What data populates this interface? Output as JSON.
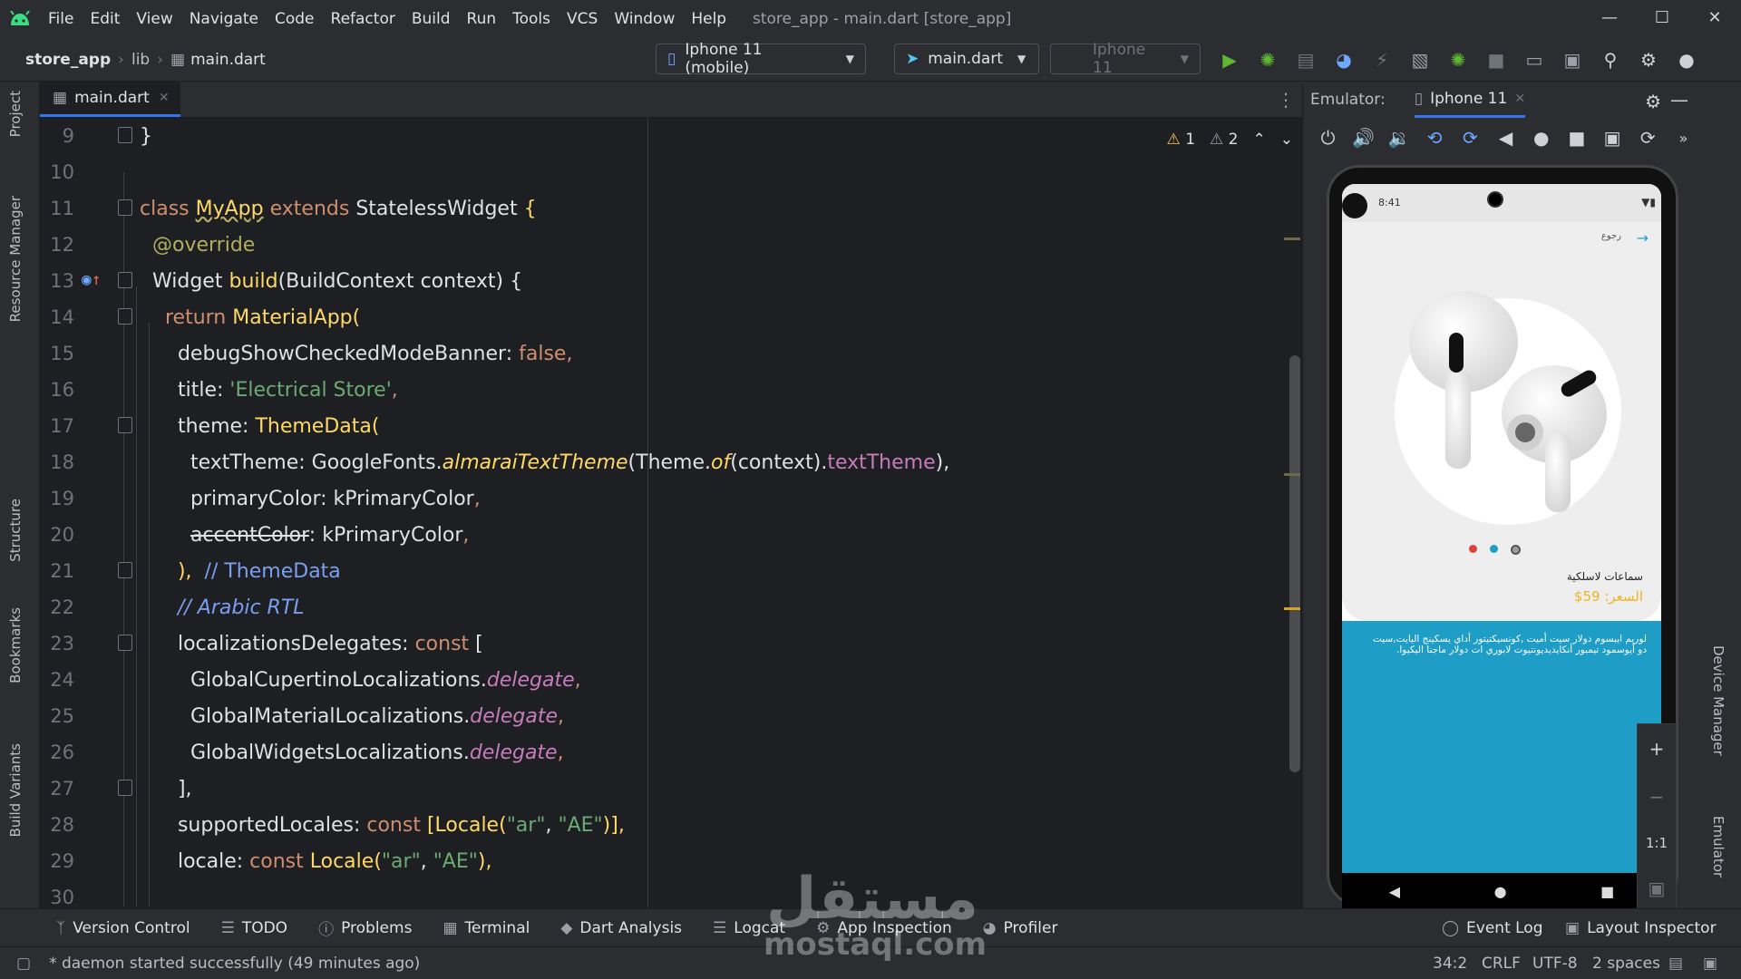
{
  "window": {
    "title": "store_app - main.dart [store_app]",
    "menu": [
      "File",
      "Edit",
      "View",
      "Navigate",
      "Code",
      "Refactor",
      "Build",
      "Run",
      "Tools",
      "VCS",
      "Window",
      "Help"
    ]
  },
  "breadcrumb": [
    "store_app",
    "lib",
    "main.dart"
  ],
  "toolbar": {
    "device_combo": "Iphone 11 (mobile)",
    "config_combo": "main.dart",
    "target_combo": "Iphone 11"
  },
  "left_tools": [
    "Project",
    "Resource Manager",
    "Structure",
    "Bookmarks",
    "Build Variants"
  ],
  "right_tools": [
    "Device Manager",
    "Emulator"
  ],
  "editor": {
    "tab": "main.dart",
    "inspections": {
      "warnings": "1",
      "weak_warnings": "2"
    },
    "lines": [
      {
        "n": "9"
      },
      {
        "n": "10"
      },
      {
        "n": "11"
      },
      {
        "n": "12"
      },
      {
        "n": "13"
      },
      {
        "n": "14"
      },
      {
        "n": "15"
      },
      {
        "n": "16"
      },
      {
        "n": "17"
      },
      {
        "n": "18"
      },
      {
        "n": "19"
      },
      {
        "n": "20"
      },
      {
        "n": "21"
      },
      {
        "n": "22"
      },
      {
        "n": "23"
      },
      {
        "n": "24"
      },
      {
        "n": "25"
      },
      {
        "n": "26"
      },
      {
        "n": "27"
      },
      {
        "n": "28"
      },
      {
        "n": "29"
      },
      {
        "n": "30"
      }
    ],
    "code": {
      "l9": "}",
      "l11_class": "class",
      "l11_name": "MyApp",
      "l11_extends": "extends",
      "l11_super": "StatelessWidget",
      "l11_brace": "{",
      "l12": "@override",
      "l13_type": "Widget",
      "l13_fn": "build",
      "l13_rest": "(BuildContext context) {",
      "l14_kw": "return",
      "l14_cls": "MaterialApp",
      "l14_paren": "(",
      "l15_key": "debugShowCheckedModeBanner: ",
      "l15_val": "false",
      "l15_end": ",",
      "l16_key": "title: ",
      "l16_val": "'Electrical Store'",
      "l16_end": ",",
      "l17_key": "theme: ",
      "l17_cls": "ThemeData",
      "l17_paren": "(",
      "l18_key": "textTheme: GoogleFonts.",
      "l18_fn": "almaraiTextTheme",
      "l18_mid": "(Theme.",
      "l18_of": "of",
      "l18_mid2": "(context).",
      "l18_prop": "textTheme",
      "l18_end": "),",
      "l19_key": "primaryColor: kPrimaryColor",
      "l19_end": ",",
      "l20_key": "accentColor",
      "l20_rest": ": kPrimaryColor",
      "l20_end": ",",
      "l21_paren": "),",
      "l21_cmt": "// ThemeData",
      "l22_cmt": "// Arabic RTL",
      "l23_key": "localizationsDelegates: ",
      "l23_kw": "const",
      "l23_br": " [",
      "l24_cls": "GlobalCupertinoLocalizations.",
      "l24_prop": "delegate",
      "l25_cls": "GlobalMaterialLocalizations.",
      "l25_prop": "delegate",
      "l26_cls": "GlobalWidgetsLocalizations.",
      "l26_prop": "delegate",
      "l27": "],",
      "l28_key": "supportedLocales: ",
      "l28_kw": "const",
      "l28_a": " [",
      "l28_cls": "Locale",
      "l28_b": "(",
      "l28_s1": "\"ar\"",
      "l28_c": ", ",
      "l28_s2": "\"AE\"",
      "l28_d": ")],",
      "l29_key": "locale: ",
      "l29_kw": "const",
      "l29_cls": " Locale",
      "l29_b": "(",
      "l29_s1": "\"ar\"",
      "l29_c": ", ",
      "l29_s2": "\"AE\"",
      "l29_d": "),",
      "comma": ","
    }
  },
  "emulator": {
    "label": "Emulator:",
    "device_tab": "Iphone 11",
    "phone": {
      "status_time": "8:41",
      "back_label": "رجوع",
      "product_name": "سماعات لاسلكية",
      "price": "السعر: 59$",
      "description": "لوريم ايبسوم دولار سيت أميت ,كونسيكتيتور أداي يسكينج اليايت,سيت دو أيوسمود تيمبور أنكايديديونتيوت لابوري ات دولار ماجنا اليكيوا.",
      "dot_colors": [
        "#e0423a",
        "#1e9ec7",
        "#9e9e9e"
      ]
    },
    "zoom": {
      "in": "+",
      "out": "−",
      "ratio": "1:1"
    }
  },
  "bottom_tools": [
    "Version Control",
    "TODO",
    "Problems",
    "Terminal",
    "Dart Analysis",
    "Logcat",
    "App Inspection",
    "Profiler"
  ],
  "bottom_right_tools": [
    "Event Log",
    "Layout Inspector"
  ],
  "status": {
    "message": "* daemon started successfully (49 minutes ago)",
    "position": "34:2",
    "line_sep": "CRLF",
    "encoding": "UTF-8",
    "indent": "2 spaces"
  },
  "watermark": {
    "arabic": "مستقل",
    "latin": "mostaql.com"
  }
}
